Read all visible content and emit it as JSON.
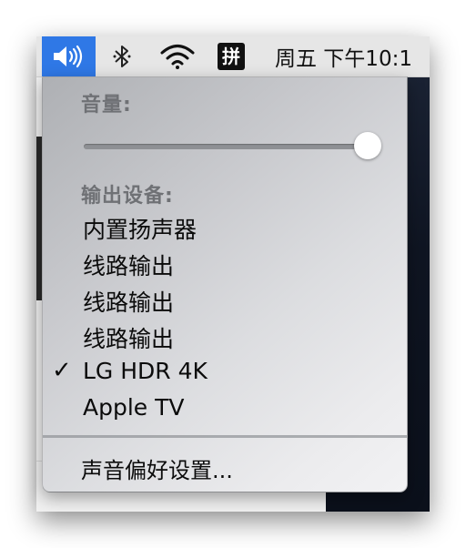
{
  "menubar": {
    "volume_icon": "speaker-volume-icon",
    "bluetooth_icon": "bluetooth-icon",
    "wifi_icon": "wifi-icon",
    "input_method": "拼",
    "clock": "周五 下午10:1",
    "accent_color": "#2f78e6"
  },
  "volume_menu": {
    "volume_label": "音量:",
    "volume_level": 1.0,
    "output_label": "输出设备:",
    "devices": [
      {
        "name": "内置扬声器",
        "selected": false
      },
      {
        "name": "线路输出",
        "selected": false
      },
      {
        "name": "线路输出",
        "selected": false
      },
      {
        "name": "线路输出",
        "selected": false
      },
      {
        "name": "LG HDR 4K",
        "selected": true
      },
      {
        "name": "Apple TV",
        "selected": false
      }
    ],
    "checkmark": "✓",
    "preferences": "声音偏好设置..."
  }
}
